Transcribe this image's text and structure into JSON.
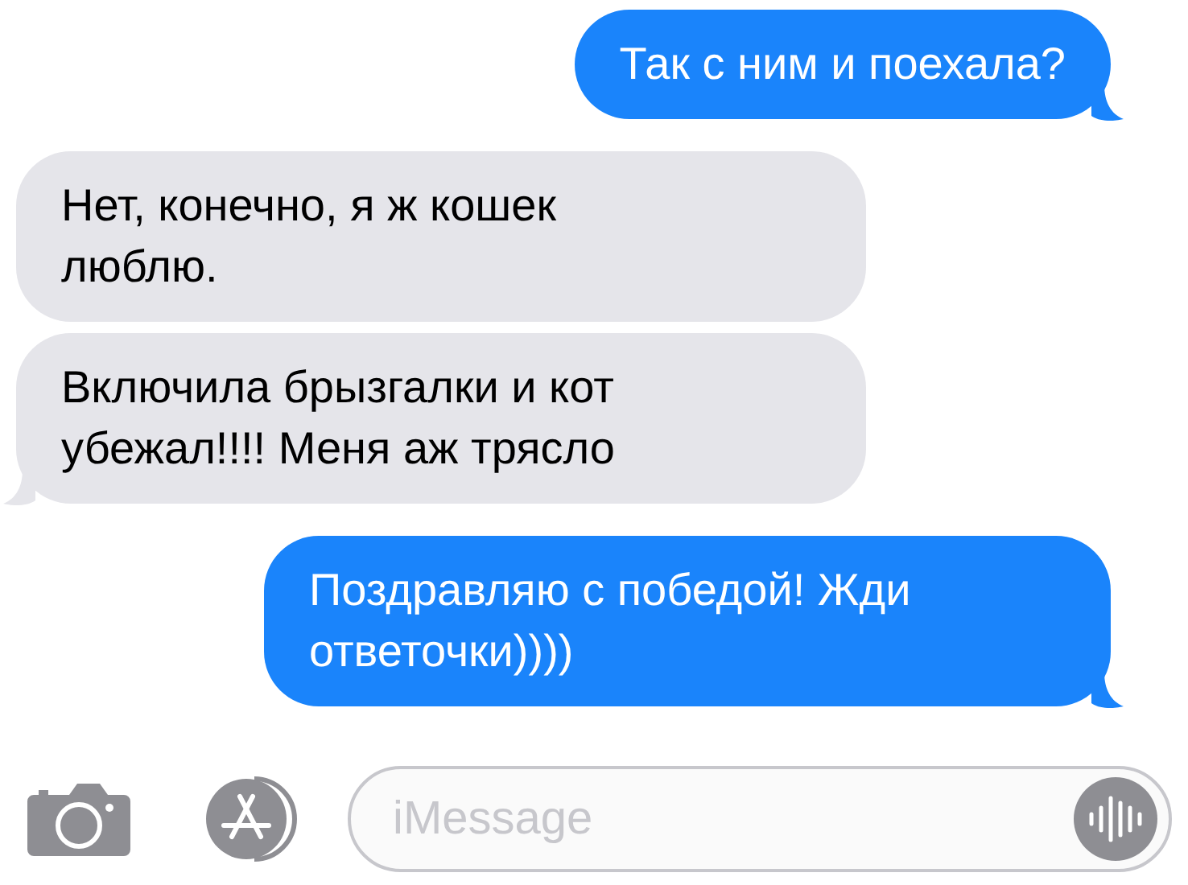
{
  "messages": [
    {
      "kind": "sent",
      "text": "Так с ним и поехала?",
      "tail": true
    },
    {
      "kind": "received",
      "text": "Нет, конечно, я ж кошек люблю.",
      "tail": false
    },
    {
      "kind": "received",
      "text": "Включила брызгалки и кот убежал!!!! Меня аж трясло",
      "tail": true
    },
    {
      "kind": "sent",
      "text": "Поздравляю с победой! Жди ответочки))))",
      "tail": true
    }
  ],
  "composer": {
    "placeholder": "iMessage"
  }
}
